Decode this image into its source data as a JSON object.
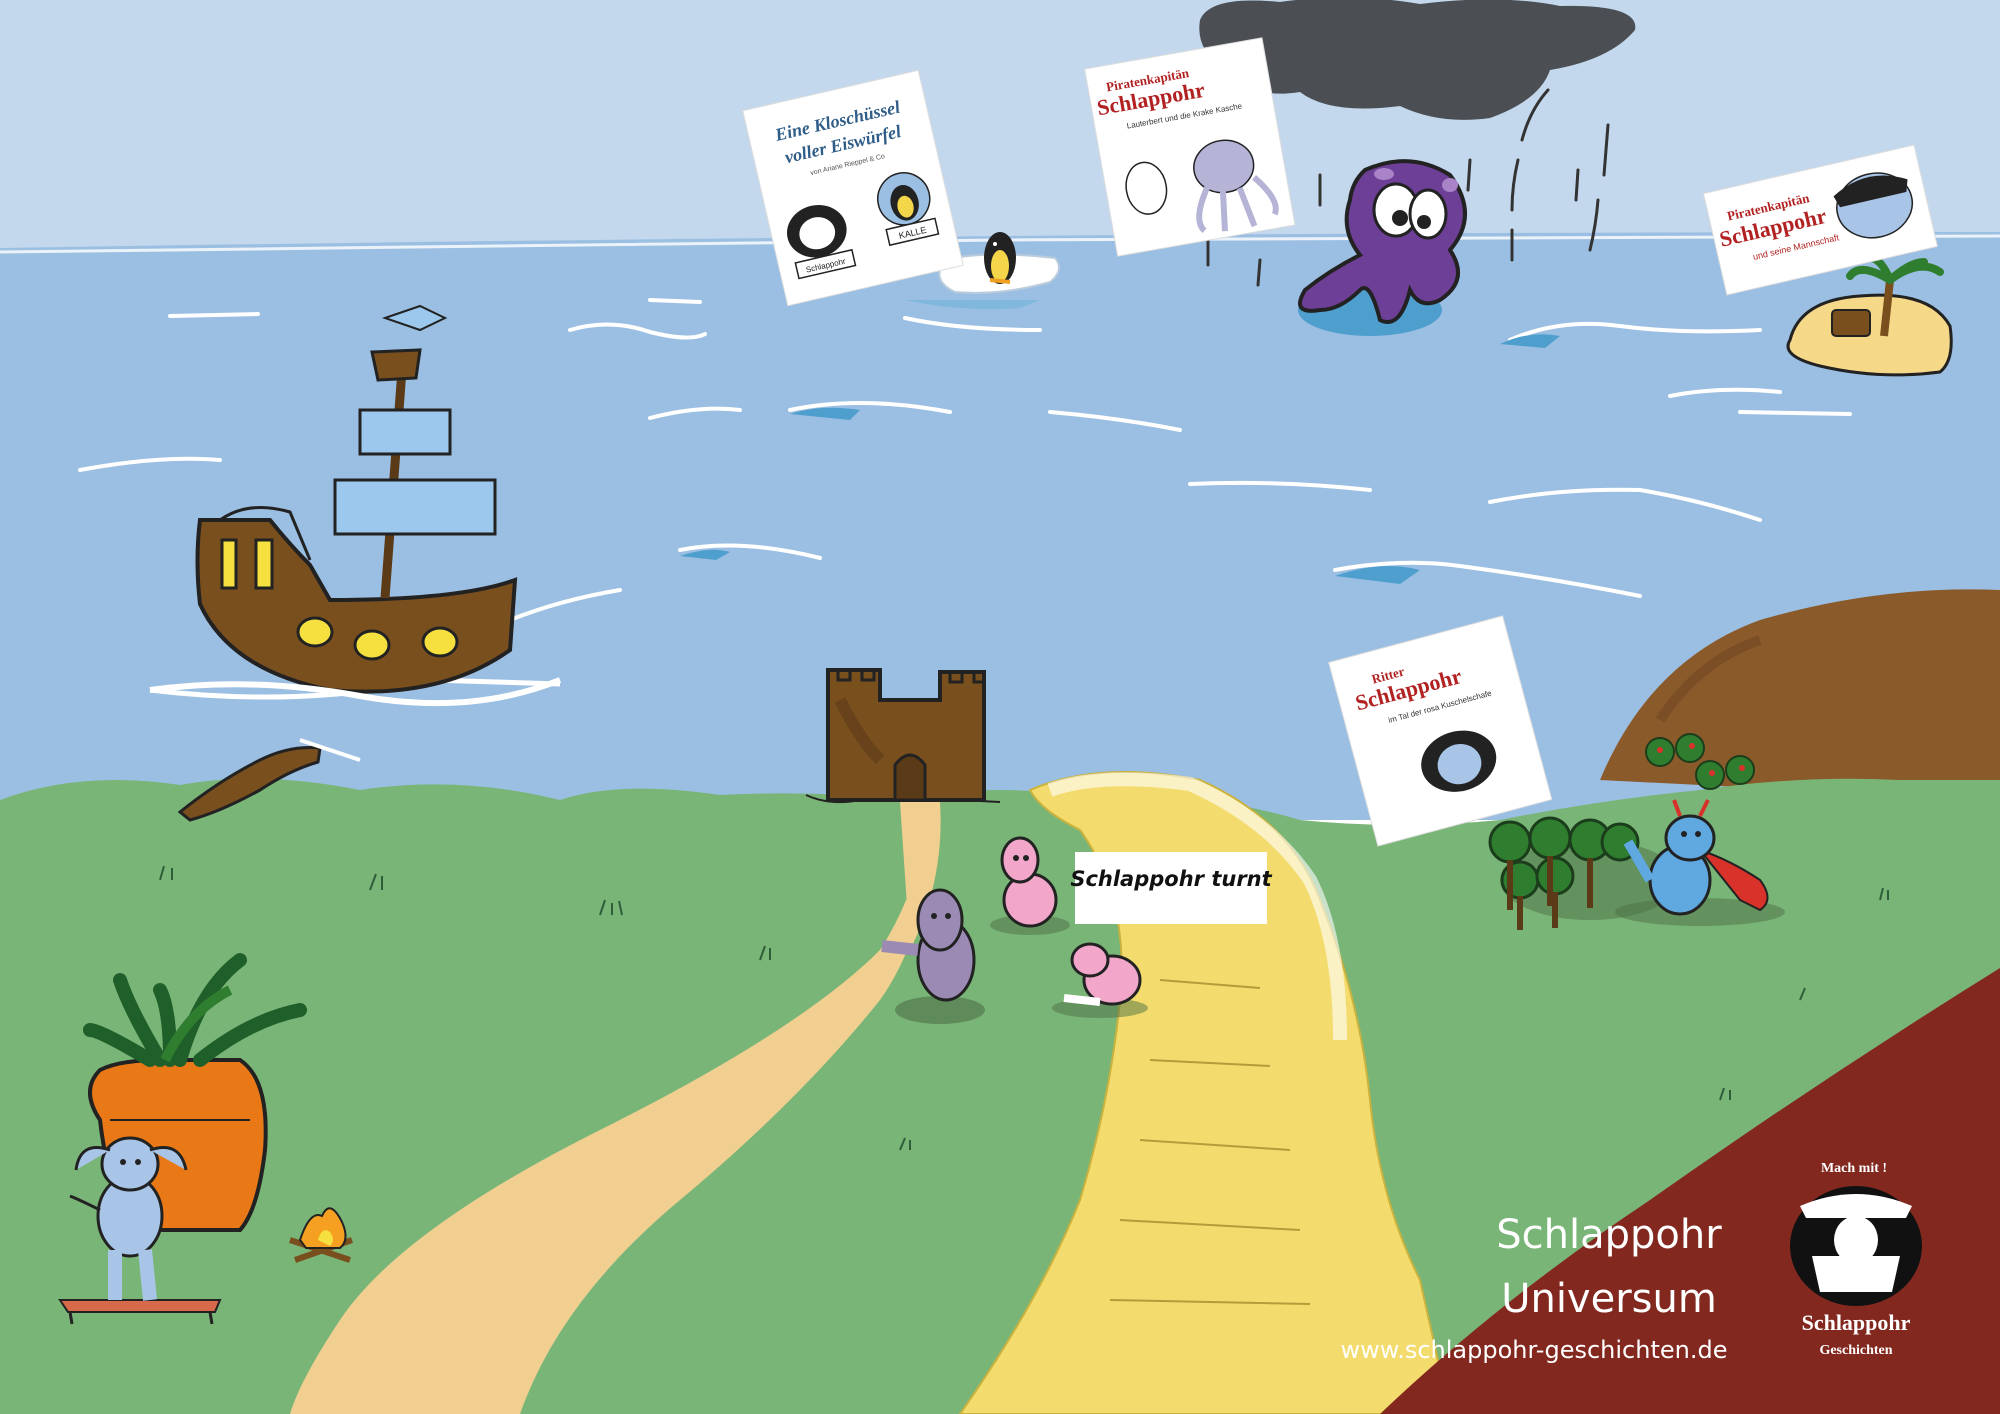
{
  "title": "Schlappohr Universum",
  "title_line1": "Schlappohr",
  "title_line2": "Universum",
  "website": "www.schlappohr-geschichten.de",
  "sign_schlappohr_turnt": "Schlappohr turnt",
  "logo": {
    "top_text": "Mach mit !",
    "name": "Schlappohr",
    "sub": "Geschichten"
  },
  "books": [
    {
      "title_line1": "Eine Kloschüssel",
      "title_line2": "voller Eiswürfel",
      "byline": "von Ariane Rieppel & Co",
      "badge_left": "Schlappohr",
      "badge_right": "KALLE"
    },
    {
      "kicker": "Piratenkapitän",
      "name": "Schlappohr",
      "subtitle": "Lauterbert und die Krake Kasche"
    },
    {
      "kicker": "Piratenkapitän",
      "name": "Schlappohr",
      "subtitle": "und seine Mannschaft"
    },
    {
      "kicker": "Ritter",
      "name": "Schlappohr",
      "subtitle": "im Tal der rosa Kuschelschafe"
    }
  ],
  "colors": {
    "sky": "#c3d8ec",
    "sea": "#9bbfe2",
    "grass": "#7ab578",
    "path_tan": "#f0cf91",
    "path_yellow": "#f3dc6d",
    "corner": "#82281e",
    "ship": "#7a4f1e",
    "octopus": "#6d3f96",
    "cloud": "#4b4f54",
    "mountain": "#8b5a2b"
  }
}
